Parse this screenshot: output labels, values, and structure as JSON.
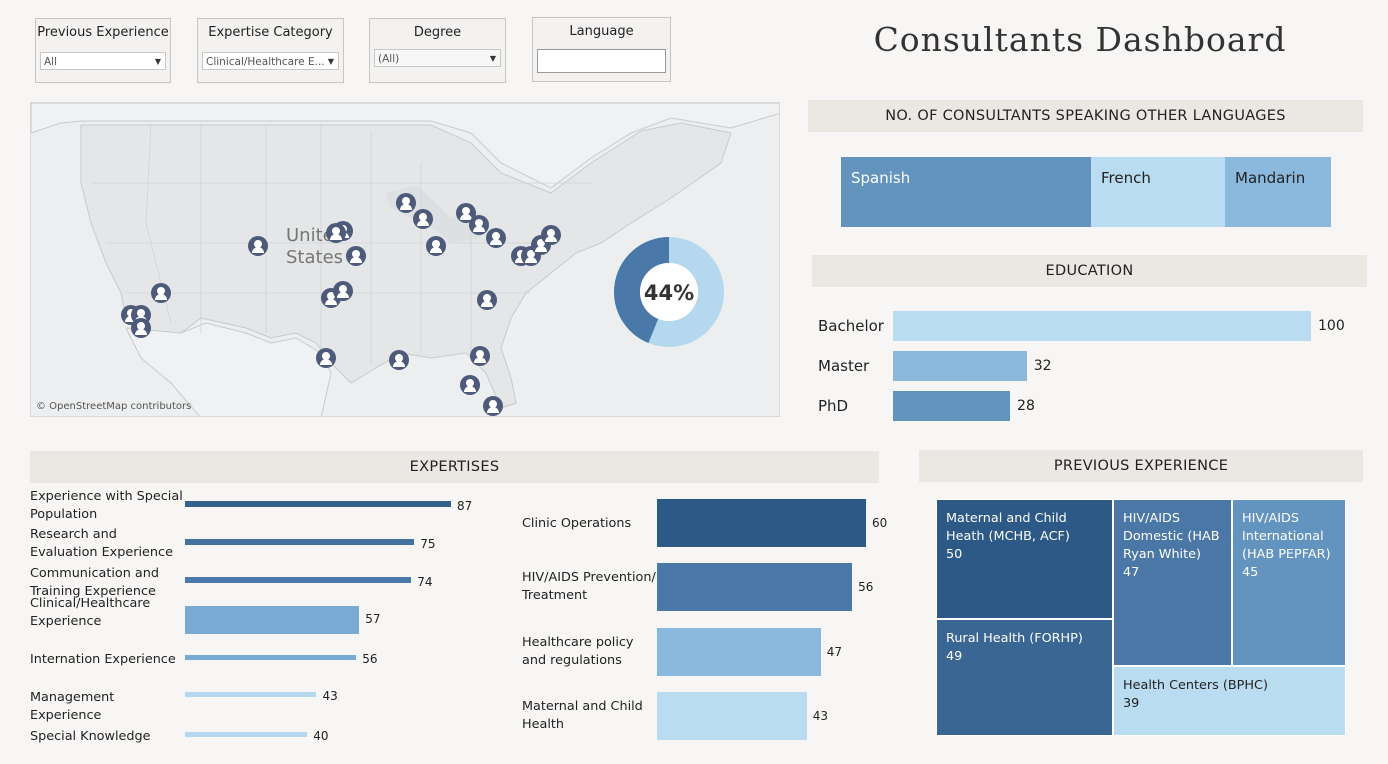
{
  "filters": {
    "previous_experience": {
      "title": "Previous Experience",
      "value": "All"
    },
    "expertise_category": {
      "title": "Expertise Category",
      "value": "Clinical/Healthcare E..."
    },
    "degree": {
      "title": "Degree",
      "value": "(All)"
    },
    "language": {
      "title": "Language",
      "value": ""
    }
  },
  "dashboard_title": "Consultants Dashboard",
  "map": {
    "country_label_1": "United",
    "country_label_2": "States",
    "credit": "© OpenStreetMap contributors",
    "donut_percent_label": "44%",
    "donut_fraction": 0.44,
    "marker_icon": "person-pin-icon",
    "colors": {
      "marker": "#4d5a7a",
      "donut_main": "#4a78a8",
      "donut_rest": "#b4d9ef"
    }
  },
  "languages": {
    "header": "NO. OF CONSULTANTS SPEAKING OTHER LANGUAGES",
    "items": [
      {
        "name": "Spanish",
        "color": "#6294be"
      },
      {
        "name": "French",
        "color": "#b9dcf0"
      },
      {
        "name": "Mandarin",
        "color": "#8bb8dd"
      }
    ]
  },
  "education": {
    "header": "EDUCATION",
    "items": [
      {
        "label": "Bachelor",
        "value": 100,
        "color": "#b9dcf0"
      },
      {
        "label": "Master",
        "value": 32,
        "color": "#8bb8dd"
      },
      {
        "label": "PhD",
        "value": 28,
        "color": "#6294be"
      }
    ]
  },
  "expertises": {
    "header": "EXPERTISES",
    "left": [
      {
        "label": "Experience with Special Population",
        "value": 87,
        "color": "#33628f"
      },
      {
        "label": "Research and Evaluation Experience",
        "value": 75,
        "color": "#44729f"
      },
      {
        "label": "Communication and Training Experience",
        "value": 74,
        "color": "#4a78a8"
      },
      {
        "label": "Clinical/Healthcare Experience",
        "value": 57,
        "color": "#79aad4"
      },
      {
        "label": "Internation Experience",
        "value": 56,
        "color": "#79aad4"
      },
      {
        "label": "Management Experience",
        "value": 43,
        "color": "#b4d9ef"
      },
      {
        "label": "Special Knowledge",
        "value": 40,
        "color": "#b4d9ef"
      }
    ],
    "right": [
      {
        "label": "Clinic Operations",
        "value": 60,
        "color": "#2d5986"
      },
      {
        "label": "HIV/AIDS Prevention/ Treatment",
        "value": 56,
        "color": "#4a78a8"
      },
      {
        "label": "Healthcare policy and regulations",
        "value": 47,
        "color": "#8bb8dd"
      },
      {
        "label": "Maternal and Child Health",
        "value": 43,
        "color": "#b9dcf0"
      }
    ]
  },
  "previous_experience": {
    "header": "PREVIOUS EXPERIENCE",
    "items": [
      {
        "label": "Maternal and Child Heath (MCHB, ACF)",
        "value": "50",
        "color": "#2c5986",
        "text_color": "#ffffff"
      },
      {
        "label": "HIV/AIDS Domestic (HAB Ryan White)",
        "value": "47",
        "color": "#4a77a6",
        "text_color": "#ffffff"
      },
      {
        "label": "HIV/AIDS International (HAB PEPFAR)",
        "value": "45",
        "color": "#6393bf",
        "text_color": "#ffffff"
      },
      {
        "label": "Rural Health (FORHP)",
        "value": "49",
        "color": "#3a6694",
        "text_color": "#ffffff"
      },
      {
        "label": "Health Centers (BPHC)",
        "value": "39",
        "color": "#b9dcf0",
        "text_color": "#222222"
      }
    ]
  }
}
